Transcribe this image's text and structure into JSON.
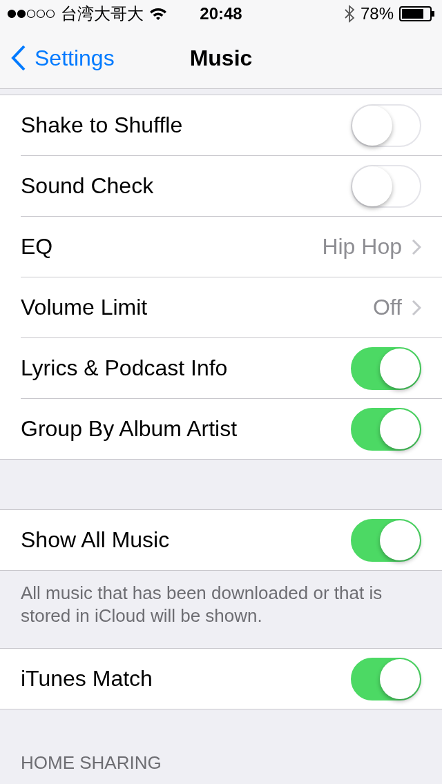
{
  "status_bar": {
    "carrier": "台湾大哥大",
    "time": "20:48",
    "battery": "78%"
  },
  "nav": {
    "back": "Settings",
    "title": "Music"
  },
  "sections": [
    {
      "rows": [
        {
          "kind": "toggle",
          "label": "Shake to Shuffle",
          "on": false
        },
        {
          "kind": "toggle",
          "label": "Sound Check",
          "on": false
        },
        {
          "kind": "value",
          "label": "EQ",
          "value": "Hip Hop"
        },
        {
          "kind": "value",
          "label": "Volume Limit",
          "value": "Off"
        },
        {
          "kind": "toggle",
          "label": "Lyrics & Podcast Info",
          "on": true
        },
        {
          "kind": "toggle",
          "label": "Group By Album Artist",
          "on": true
        }
      ]
    },
    {
      "rows": [
        {
          "kind": "toggle",
          "label": "Show All Music",
          "on": true
        }
      ],
      "footer": "All music that has been downloaded or that is stored in iCloud will be shown."
    },
    {
      "rows": [
        {
          "kind": "toggle",
          "label": "iTunes Match",
          "on": true
        }
      ]
    },
    {
      "header": "HOME SHARING"
    }
  ]
}
